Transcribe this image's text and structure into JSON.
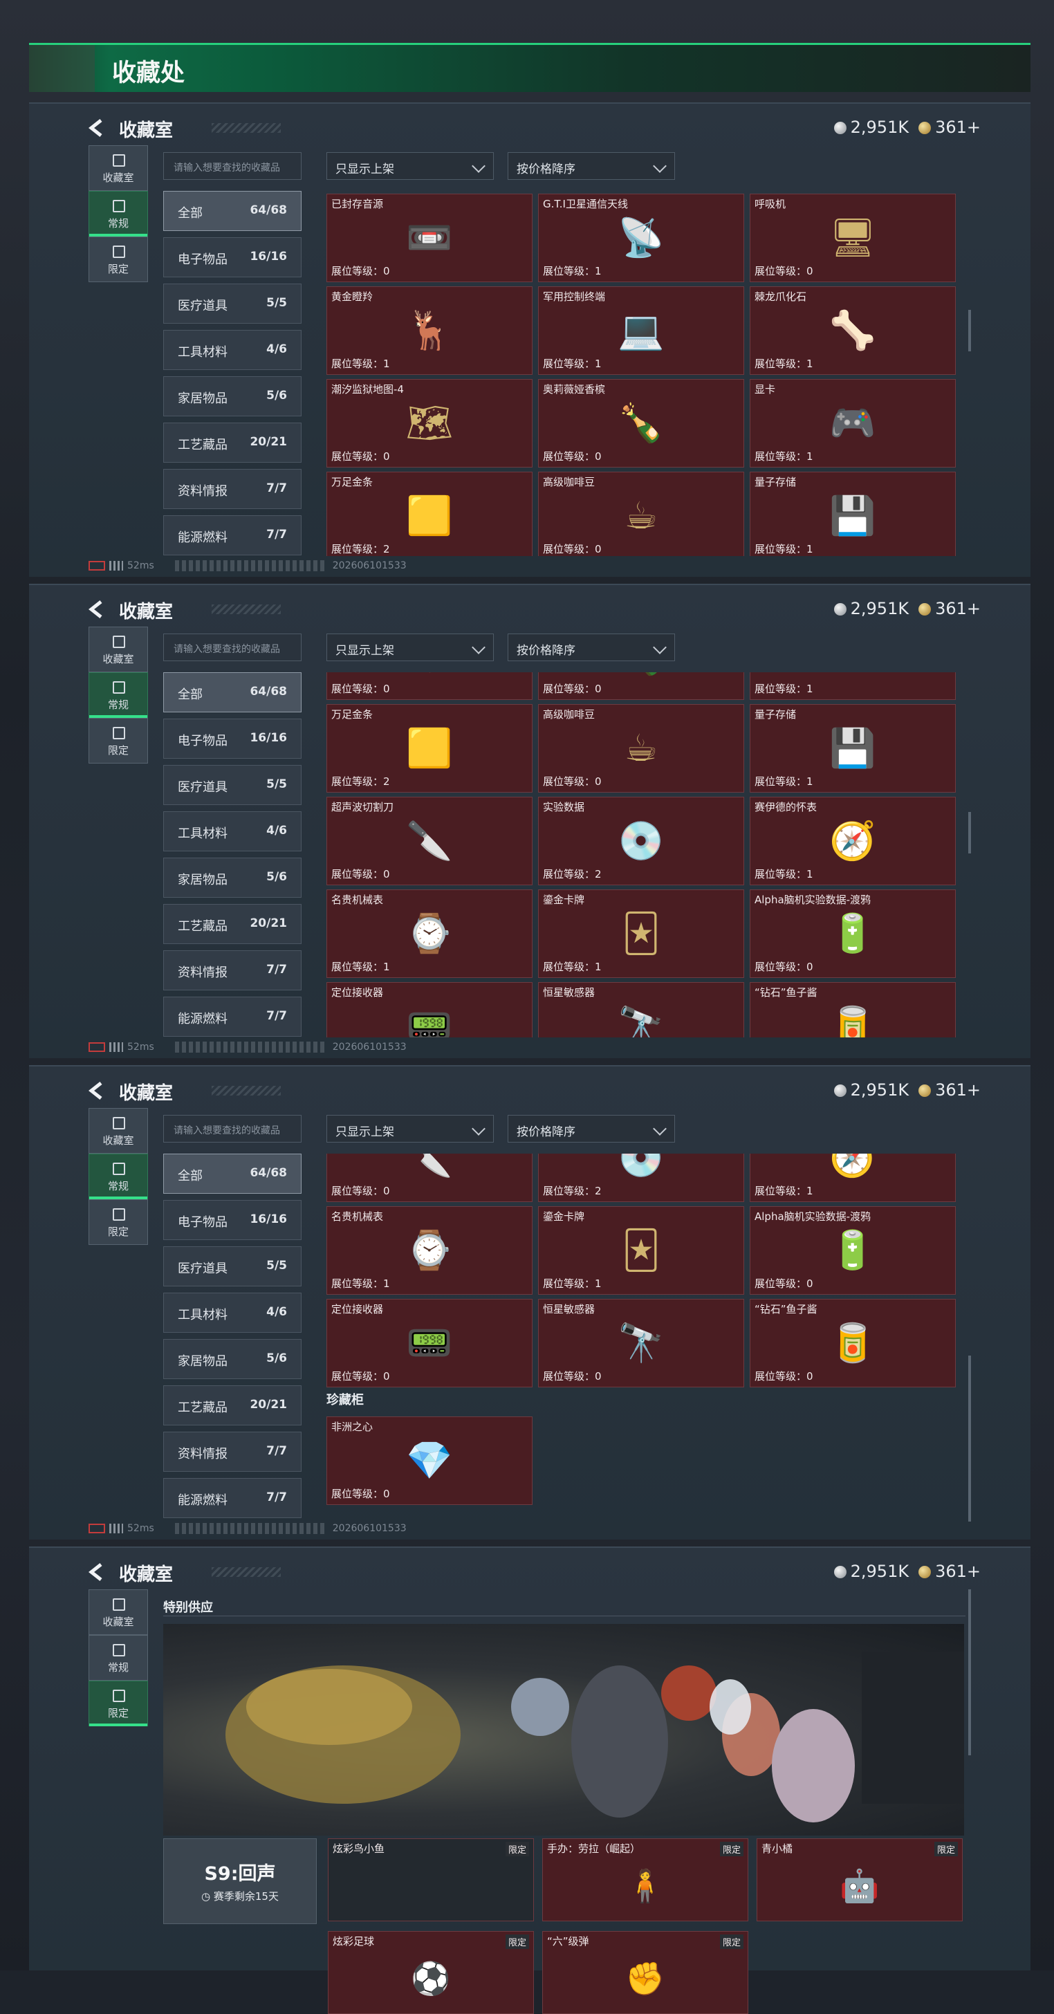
{
  "page_title": "收藏处",
  "panel_title": "收藏室",
  "currency": {
    "silver": "2,951K",
    "gold": "361+"
  },
  "side_tabs": [
    {
      "label": "收藏室"
    },
    {
      "label": "常规"
    },
    {
      "label": "限定"
    }
  ],
  "search_placeholder": "请输入想要查找的收藏品",
  "filters": {
    "show": "只显示上架",
    "sort": "按价格降序"
  },
  "categories": [
    {
      "name": "全部",
      "count": "64/68"
    },
    {
      "name": "电子物品",
      "count": "16/16"
    },
    {
      "name": "医疗道具",
      "count": "5/5"
    },
    {
      "name": "工具材料",
      "count": "4/6"
    },
    {
      "name": "家居物品",
      "count": "5/6"
    },
    {
      "name": "工艺藏品",
      "count": "20/21"
    },
    {
      "name": "资料情报",
      "count": "7/7"
    },
    {
      "name": "能源燃料",
      "count": "7/7"
    }
  ],
  "items": [
    {
      "name": "已封存音源",
      "level": "展位等级：0",
      "icon": "tape-recorder-icon",
      "glyph": "📼"
    },
    {
      "name": "G.T.I卫星通信天线",
      "level": "展位等级：1",
      "icon": "satellite-dish-icon",
      "glyph": "📡"
    },
    {
      "name": "呼吸机",
      "level": "展位等级：0",
      "icon": "ventilator-icon",
      "glyph": "🖥"
    },
    {
      "name": "黄金瞪羚",
      "level": "展位等级：1",
      "icon": "golden-gazelle-icon",
      "glyph": "🦌"
    },
    {
      "name": "军用控制终端",
      "level": "展位等级：1",
      "icon": "control-terminal-icon",
      "glyph": "💻"
    },
    {
      "name": "棘龙爪化石",
      "level": "展位等级：1",
      "icon": "claw-fossil-icon",
      "glyph": "🦴"
    },
    {
      "name": "潮汐监狱地图-4",
      "level": "展位等级：0",
      "icon": "map-icon",
      "glyph": "🗺"
    },
    {
      "name": "奥莉薇娅香槟",
      "level": "展位等级：0",
      "icon": "champagne-icon",
      "glyph": "🍾"
    },
    {
      "name": "显卡",
      "level": "展位等级：1",
      "icon": "graphics-card-icon",
      "glyph": "🎮"
    },
    {
      "name": "万足金条",
      "level": "展位等级：2",
      "icon": "gold-bar-icon",
      "glyph": "🟨"
    },
    {
      "name": "高级咖啡豆",
      "level": "展位等级：0",
      "icon": "coffee-bag-icon",
      "glyph": "☕"
    },
    {
      "name": "量子存储",
      "level": "展位等级：1",
      "icon": "usb-drive-icon",
      "glyph": "💾"
    },
    {
      "name": "超声波切割刀",
      "level": "展位等级：0",
      "icon": "cutter-icon",
      "glyph": "🔪"
    },
    {
      "name": "实验数据",
      "level": "展位等级：2",
      "icon": "disc-icon",
      "glyph": "💿"
    },
    {
      "name": "赛伊德的怀表",
      "level": "展位等级：1",
      "icon": "pocket-watch-icon",
      "glyph": "🧭"
    },
    {
      "name": "名贵机械表",
      "level": "展位等级：1",
      "icon": "wristwatch-icon",
      "glyph": "⌚"
    },
    {
      "name": "鎏金卡牌",
      "level": "展位等级：1",
      "icon": "gilded-card-icon",
      "glyph": "🃏"
    },
    {
      "name": "Alpha脑机实验数据-渡鸦",
      "level": "展位等级：0",
      "icon": "data-canister-icon",
      "glyph": "🔋"
    },
    {
      "name": "定位接收器",
      "level": "展位等级：0",
      "icon": "receiver-icon",
      "glyph": "📟"
    },
    {
      "name": "恒星敏感器",
      "level": "展位等级：0",
      "icon": "star-sensor-icon",
      "glyph": "🔭"
    },
    {
      "name": "“钻石”鱼子酱",
      "level": "展位等级：0",
      "icon": "caviar-tin-icon",
      "glyph": "🥫"
    }
  ],
  "treasure_section": {
    "label": "珍藏柜",
    "item": {
      "name": "非洲之心",
      "level": "展位等级：0",
      "icon": "diamond-icon",
      "glyph": "💎"
    }
  },
  "special": {
    "label": "特别供应",
    "season": {
      "title": "S9:回声",
      "remaining": "赛季剩余15天"
    },
    "items": [
      {
        "name": "炫彩鸟小鱼",
        "tag": "限定",
        "glyph": ""
      },
      {
        "name": "手办：劳拉（崛起）",
        "tag": "限定",
        "glyph": "🧍"
      },
      {
        "name": "青小橘",
        "tag": "限定",
        "glyph": "🤖"
      },
      {
        "name": "炫彩足球",
        "tag": "限定",
        "glyph": "⚽"
      },
      {
        "name": "“六”级弹",
        "tag": "限定",
        "glyph": "✊"
      }
    ]
  },
  "footer": {
    "ping": "52ms",
    "build": "202606101533"
  }
}
